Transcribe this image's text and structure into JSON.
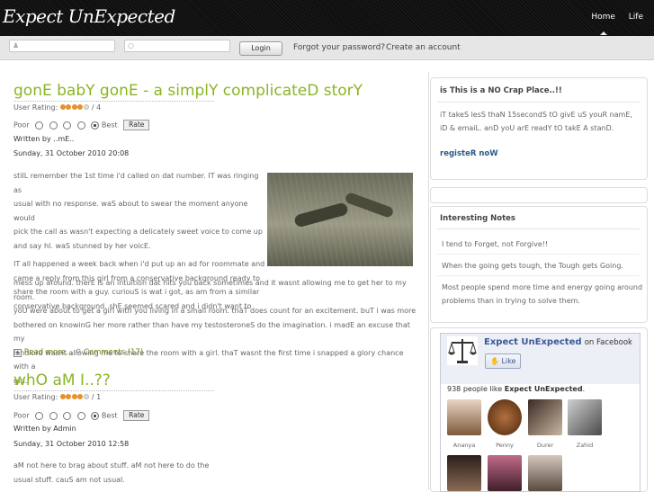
{
  "header": {
    "logo": "Expect UnExpected",
    "nav": [
      {
        "label": "Home"
      },
      {
        "label": "Life"
      }
    ]
  },
  "login": {
    "username_placeholder": "",
    "password_placeholder": "",
    "login_label": "Login",
    "forgot_label": "Forgot your password?",
    "create_label": "Create an account"
  },
  "posts": [
    {
      "title": "gonE babY gonE - a simplY complicateD storY",
      "rating_label": "User Rating:",
      "rating_count": "/ 4",
      "rating_stars": 4,
      "poor_label": "Poor",
      "best_label": "Best",
      "rate_label": "Rate",
      "author": "Written by ..mE..",
      "date": "Sunday, 31 October 2010 20:08",
      "paragraphs": [
        "stilL remember the 1st time i'd called on dat number. IT was ringing as",
        "usual with no response. waS about to swear the moment anyone would",
        "pick the call as wasn't expecting a delicately sweet voice to come up",
        "and say hI. waS stunned by her voicE.",
        "IT all happened a week back when i'd put up an ad for roommate and",
        "came a reply from this girl from a conservative background ready to",
        "share the room with a guy. curiouS is wat i got, as am from a similar",
        "conservative background. shE seemed scared and i didn't want to",
        "mess up around. therE is an intuition dat hits you back sometimes and it wasnt allowing me to get her to my room.",
        "yoU were about to get a girl with you living in a small room. thaT does count for an excitement. buT i was more",
        "bothered on knowinG her more rather than have my testosteroneS do the imagination. i madE an excuse that my",
        "landlord wasnt allowing me to share the room with a girl. thaT wasnt the first time i snapped a glory chance with a",
        "girl."
      ],
      "read_more": "Read more...",
      "comments": "Comments (17)"
    },
    {
      "title": "whO aM I..??",
      "rating_label": "User Rating:",
      "rating_count": "/ 1",
      "rating_stars": 4,
      "poor_label": "Poor",
      "best_label": "Best",
      "rate_label": "Rate",
      "author": "Written by Admin",
      "date": "Sunday, 31 October 2010 12:58",
      "paragraphs": [
        "aM not here to brag about stuff. aM not here to do the",
        "usual stuff. cauS am not usual."
      ]
    }
  ],
  "sidebar": {
    "box1": {
      "title": "is This is a NO Crap Place..!!",
      "text": [
        "iT takeS lesS thaN 15secondS tO givE uS youR namE,",
        "iD & emaiL. anD yoU arE readY tO takE A stanD."
      ],
      "link": "registeR noW"
    },
    "box2": {
      "title": "Interesting Notes",
      "notes": [
        "I tend to Forget, not Forgive!!",
        "When the going gets tough, the Tough gets Going.",
        "Most people spend more time and energy going around",
        "problems than in trying to solve them."
      ]
    },
    "facebook": {
      "page_name": "Expect UnExpected",
      "on_facebook": "on Facebook",
      "like_label": "Like",
      "likes_prefix": "938 people like",
      "likes_page": "Expect UnExpected",
      "fans": [
        {
          "name": "Ananya"
        },
        {
          "name": "Penny"
        },
        {
          "name": "Durer"
        },
        {
          "name": "Zahid"
        }
      ]
    }
  },
  "colors": {
    "accent": "#8ab524",
    "link": "#2b5a8a",
    "star": "#e8902c"
  }
}
